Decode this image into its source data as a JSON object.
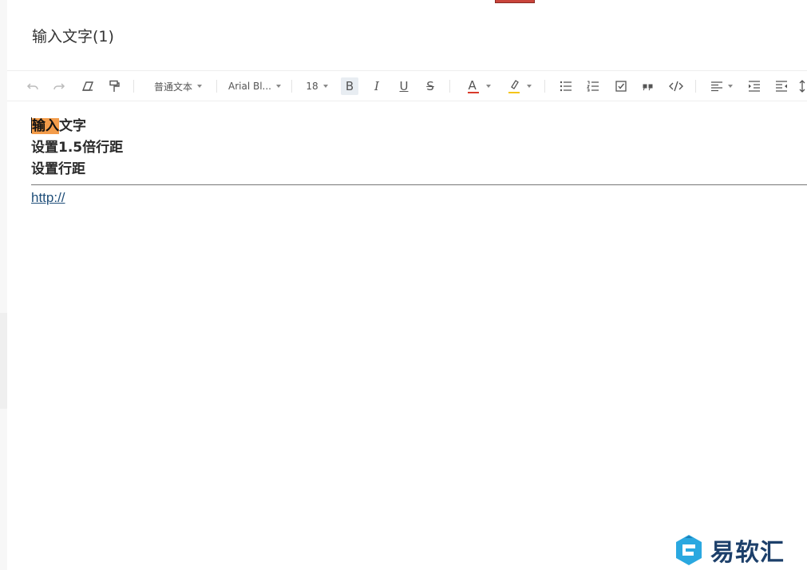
{
  "document": {
    "title": "输入文字(1)"
  },
  "toolbar": {
    "paragraph_style": "普通文本",
    "font_family": "Arial Bl...",
    "font_size": "18",
    "bold_letter": "B",
    "italic_letter": "I",
    "underline_letter": "U",
    "strike_letter": "S",
    "font_color_letter": "A",
    "colors": {
      "font_color_bar": "#d93a2b",
      "highlight_bar": "#f5c518",
      "active_bg": "#e8edf2"
    }
  },
  "editor": {
    "line1_selected": "输入",
    "line1_rest": "文字",
    "line2": "设置1.5倍行距",
    "line3": "设置行距",
    "link": "http://",
    "colors": {
      "selection": "#f39c4a",
      "link": "#1f4e79"
    }
  },
  "watermark": {
    "text": "易软汇",
    "color": "#1c3f6a",
    "icon": "yiruanhui-logo-icon"
  }
}
